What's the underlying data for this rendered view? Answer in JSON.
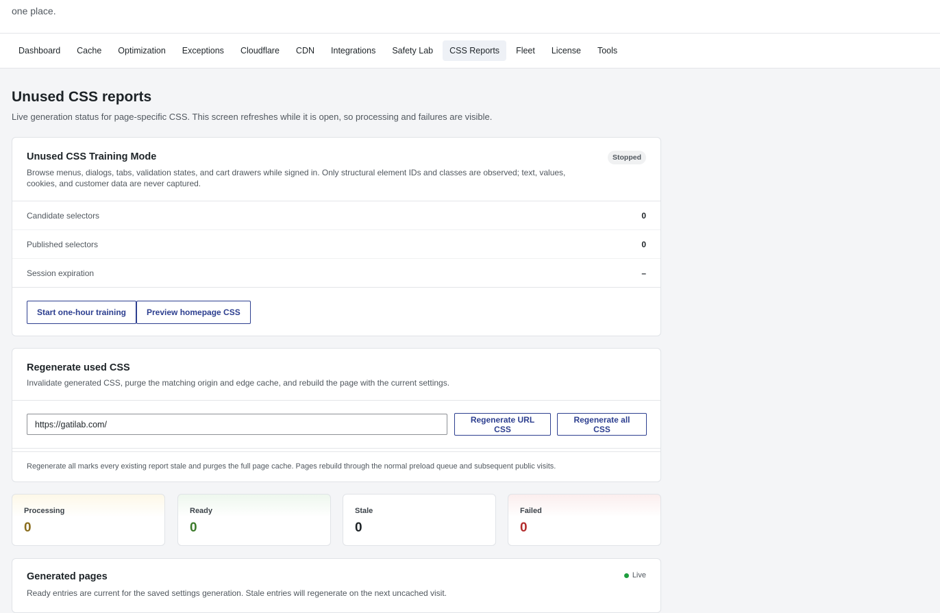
{
  "intro": {
    "text": "one place."
  },
  "tabs": [
    {
      "label": "Dashboard"
    },
    {
      "label": "Cache"
    },
    {
      "label": "Optimization"
    },
    {
      "label": "Exceptions"
    },
    {
      "label": "Cloudflare"
    },
    {
      "label": "CDN"
    },
    {
      "label": "Integrations"
    },
    {
      "label": "Safety Lab"
    },
    {
      "label": "CSS Reports",
      "active": true
    },
    {
      "label": "Fleet"
    },
    {
      "label": "License"
    },
    {
      "label": "Tools"
    }
  ],
  "page": {
    "title": "Unused CSS reports",
    "subtitle": "Live generation status for page-specific CSS. This screen refreshes while it is open, so processing and failures are visible."
  },
  "training": {
    "title": "Unused CSS Training Mode",
    "status": "Stopped",
    "description": "Browse menus, dialogs, tabs, validation states, and cart drawers while signed in. Only structural element IDs and classes are observed; text, values, cookies, and customer data are never captured.",
    "rows": [
      {
        "label": "Candidate selectors",
        "value": "0"
      },
      {
        "label": "Published selectors",
        "value": "0"
      },
      {
        "label": "Session expiration",
        "value": "–"
      }
    ],
    "start_button": "Start one-hour training",
    "preview_button": "Preview homepage CSS"
  },
  "regen": {
    "title": "Regenerate used CSS",
    "description": "Invalidate generated CSS, purge the matching origin and edge cache, and rebuild the page with the current settings.",
    "url_value": "https://gatilab.com/",
    "url_button": "Regenerate URL CSS",
    "all_button": "Regenerate all CSS",
    "note": "Regenerate all marks every existing report stale and purges the full page cache. Pages rebuild through the normal preload queue and subsequent public visits."
  },
  "stats": {
    "processing": {
      "label": "Processing",
      "value": "0"
    },
    "ready": {
      "label": "Ready",
      "value": "0"
    },
    "stale": {
      "label": "Stale",
      "value": "0"
    },
    "failed": {
      "label": "Failed",
      "value": "0"
    }
  },
  "generated": {
    "title": "Generated pages",
    "live_label": "Live",
    "description": "Ready entries are current for the saved settings generation. Stale entries will regenerate on the next uncached visit."
  },
  "colors": {
    "accent": "#2c3e8f",
    "processing": "#8a6d1d",
    "ready": "#3b7a2a",
    "failed": "#b32d2e",
    "live": "#1e9e3e"
  }
}
